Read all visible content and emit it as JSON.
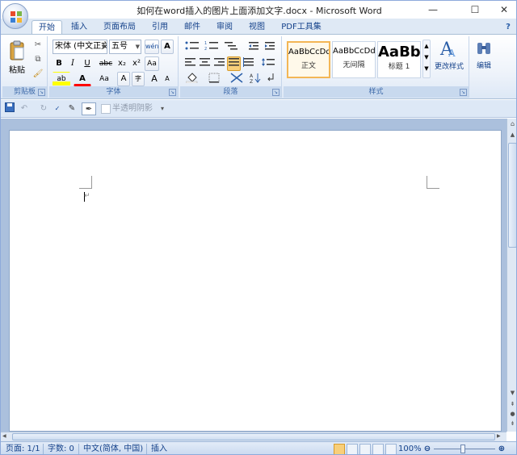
{
  "window": {
    "title": "如何在word插入的图片上面添加文字.docx - Microsoft Word"
  },
  "controls": {
    "min": "—",
    "max": "☐",
    "close": "✕",
    "help": "?"
  },
  "tabs": [
    "开始",
    "插入",
    "页面布局",
    "引用",
    "邮件",
    "审阅",
    "视图",
    "PDF工具集"
  ],
  "ribbon": {
    "clipboard": {
      "label": "剪贴板",
      "paste": "粘贴"
    },
    "font": {
      "label": "字体",
      "name": "宋体 (中文正文)",
      "size": "五号",
      "bold": "B",
      "italic": "I",
      "underline": "U",
      "strike": "abc",
      "sub": "x₂",
      "sup": "x²",
      "clear": "A",
      "grow": "A",
      "shrink": "A",
      "case": "Aa",
      "char_border": "A",
      "enclose": "字",
      "wen": "wén",
      "highlight": "ab",
      "fontcolor": "A",
      "aa": "Aa"
    },
    "paragraph": {
      "label": "段落"
    },
    "styles": {
      "label": "样式",
      "items": [
        {
          "sample": "AaBbCcDd",
          "name": "正文"
        },
        {
          "sample": "AaBbCcDd",
          "name": "无间隔"
        },
        {
          "sample": "AaBb",
          "name": "标题 1"
        }
      ],
      "change": "更改样式"
    },
    "editing": {
      "label": "编辑"
    }
  },
  "qat": {
    "transparency_label": "半透明阴影"
  },
  "status": {
    "page": "页面: 1/1",
    "words": "字数: 0",
    "lang": "中文(简体, 中国)",
    "mode": "插入",
    "zoom": "100%"
  },
  "colors": {
    "accent": "#15428b",
    "ribbon": "#dfe9f5",
    "highlight": "#ffff00",
    "fontcolor": "#ff0000"
  }
}
